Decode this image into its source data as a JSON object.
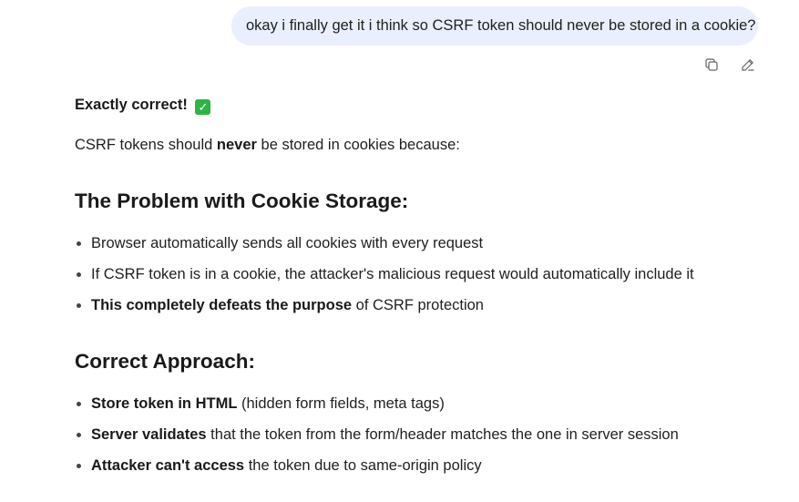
{
  "user_message": {
    "text": "okay i finally get it i think so CSRF token should never be stored in a cookie?"
  },
  "message_actions": {
    "copy_icon": "copy-icon",
    "edit_icon": "pencil-icon"
  },
  "answer": {
    "intro_bold": "Exactly correct!",
    "intro_emoji": "✓",
    "statement": {
      "prefix": "CSRF tokens should ",
      "bold": "never",
      "suffix": " be stored in cookies because:"
    },
    "section1": {
      "title": "The Problem with Cookie Storage:",
      "bullets": [
        {
          "bold": "",
          "text": "Browser automatically sends all cookies with every request"
        },
        {
          "bold": "",
          "text": "If CSRF token is in a cookie, the attacker's malicious request would automatically include it"
        },
        {
          "bold": "This completely defeats the purpose",
          "text": " of CSRF protection"
        }
      ]
    },
    "section2": {
      "title": "Correct Approach:",
      "bullets": [
        {
          "bold": "Store token in HTML",
          "text": " (hidden form fields, meta tags)"
        },
        {
          "bold": "Server validates",
          "text": " that the token from the form/header matches the one in server session"
        },
        {
          "bold": "Attacker can't access",
          "text": " the token due to same-origin policy"
        }
      ]
    }
  },
  "colors": {
    "user_bubble_bg": "#e9effc",
    "check_green": "#2fb344",
    "text": "#1f1f1f"
  }
}
